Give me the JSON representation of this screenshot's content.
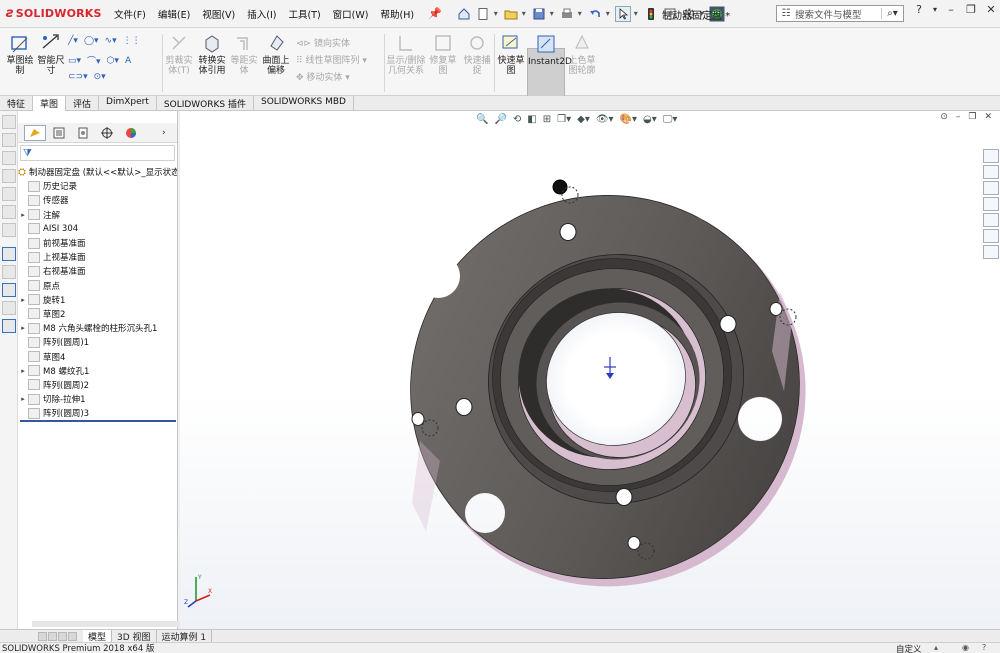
{
  "app": {
    "logo_text": "SOLIDWORKS",
    "menus": [
      "文件(F)",
      "编辑(E)",
      "视图(V)",
      "插入(I)",
      "工具(T)",
      "窗口(W)",
      "帮助(H)"
    ],
    "document_title": "制动器固定盘 *",
    "search_placeholder": "搜索文件与模型",
    "help_label": "?"
  },
  "ribbon": {
    "sketch": "草图绘\n制",
    "smart_dim": "智能尺\n寸",
    "trim": "剪裁实\n体(T)",
    "convert": "转换实\n体引用",
    "offset": "等距实\n体",
    "surface_offset": "曲面上\n偏移",
    "mirror": "镜向实体",
    "linear_pattern": "线性草图阵列",
    "move": "移动实体",
    "relations": "显示/删除\n几何关系",
    "repair": "修复草\n图",
    "quick_snap": "快速捕\n捉",
    "rapid_sketch": "快速草\n图",
    "instant2d": "Instant2D",
    "shade": "上色草\n图轮廓"
  },
  "command_tabs": [
    "特征",
    "草图",
    "评估",
    "DimXpert",
    "SOLIDWORKS 插件",
    "SOLIDWORKS MBD"
  ],
  "feature_tree": {
    "root": "制动器固定盘 (默认<<默认>_显示状态",
    "nodes": [
      {
        "label": "历史记录",
        "exp": ""
      },
      {
        "label": "传感器",
        "exp": ""
      },
      {
        "label": "注解",
        "exp": "▸"
      },
      {
        "label": "AISI 304",
        "exp": ""
      },
      {
        "label": "前视基准面",
        "exp": ""
      },
      {
        "label": "上视基准面",
        "exp": ""
      },
      {
        "label": "右视基准面",
        "exp": ""
      },
      {
        "label": "原点",
        "exp": ""
      },
      {
        "label": "旋转1",
        "exp": "▸"
      },
      {
        "label": "草图2",
        "exp": ""
      },
      {
        "label": "M8 六角头螺栓的柱形沉头孔1",
        "exp": "▸"
      },
      {
        "label": "阵列(圆周)1",
        "exp": ""
      },
      {
        "label": "草图4",
        "exp": ""
      },
      {
        "label": "M8 螺纹孔1",
        "exp": "▸"
      },
      {
        "label": "阵列(圆周)2",
        "exp": ""
      },
      {
        "label": "切除-拉伸1",
        "exp": "▸"
      },
      {
        "label": "阵列(圆周)3",
        "exp": ""
      }
    ]
  },
  "model_tabs": [
    "模型",
    "3D 视图",
    "运动算例 1"
  ],
  "status": {
    "app_version": "SOLIDWORKS Premium 2018 x64 版",
    "units": "自定义"
  },
  "colors": {
    "part_face": "#5f5a58",
    "part_edge": "#d6b9cf",
    "brand": "#d7262e"
  }
}
